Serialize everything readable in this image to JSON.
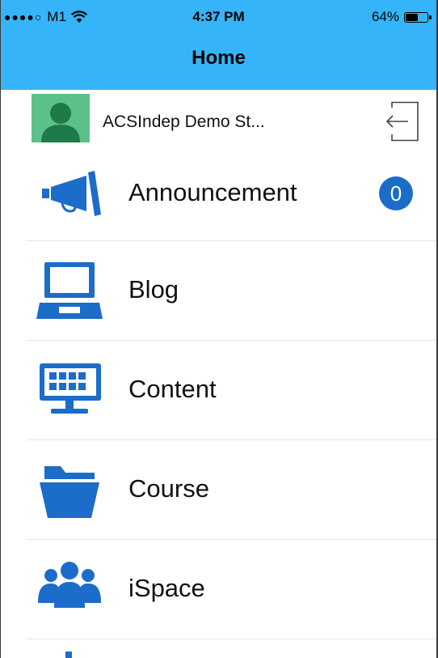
{
  "status_bar": {
    "signal": "●●●●○",
    "carrier": "M1",
    "time": "4:37 PM",
    "battery_text": "64%",
    "battery_level": 0.64
  },
  "header": {
    "title": "Home"
  },
  "profile": {
    "name": "ACSIndep Demo St..."
  },
  "menu": [
    {
      "label": "Announcement",
      "icon": "megaphone-icon",
      "badge": "0"
    },
    {
      "label": "Blog",
      "icon": "laptop-icon"
    },
    {
      "label": "Content",
      "icon": "monitor-grid-icon"
    },
    {
      "label": "Course",
      "icon": "folder-icon"
    },
    {
      "label": "iSpace",
      "icon": "group-icon"
    }
  ],
  "colors": {
    "header_bg": "#35b4f9",
    "icon_blue": "#1c6cc9",
    "avatar_bg": "#5cc08a",
    "avatar_fg": "#1e7a47"
  }
}
